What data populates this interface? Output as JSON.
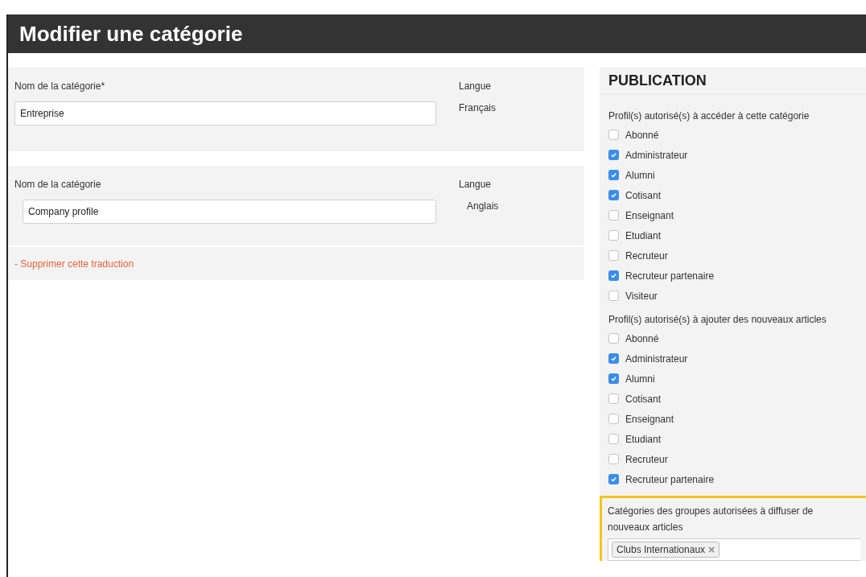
{
  "header": {
    "title": "Modifier une catégorie"
  },
  "translations": [
    {
      "name_label": "Nom de la catégorie*",
      "name_value": "Entreprise",
      "lang_label": "Langue",
      "lang_value": "Français",
      "indented": false
    },
    {
      "name_label": "Nom de la catégorie",
      "name_value": "Company profile",
      "lang_label": "Langue",
      "lang_value": "Anglais",
      "indented": true
    }
  ],
  "remove_link": "- Supprimer cette traduction",
  "publication": {
    "title": "PUBLICATION",
    "groups": [
      {
        "label": "Profil(s) autorisé(s) à accéder à cette catégorie",
        "options": [
          {
            "label": "Abonné",
            "checked": false
          },
          {
            "label": "Administrateur",
            "checked": true
          },
          {
            "label": "Alumni",
            "checked": true
          },
          {
            "label": "Cotisant",
            "checked": true
          },
          {
            "label": "Enseignant",
            "checked": false
          },
          {
            "label": "Etudiant",
            "checked": false
          },
          {
            "label": "Recruteur",
            "checked": false
          },
          {
            "label": "Recruteur partenaire",
            "checked": true
          },
          {
            "label": "Visiteur",
            "checked": false
          }
        ]
      },
      {
        "label": "Profil(s) autorisé(s) à ajouter des nouveaux articles",
        "options": [
          {
            "label": "Abonné",
            "checked": false
          },
          {
            "label": "Administrateur",
            "checked": true
          },
          {
            "label": "Alumni",
            "checked": true
          },
          {
            "label": "Cotisant",
            "checked": false
          },
          {
            "label": "Enseignant",
            "checked": false
          },
          {
            "label": "Etudiant",
            "checked": false
          },
          {
            "label": "Recruteur",
            "checked": false
          },
          {
            "label": "Recruteur partenaire",
            "checked": true
          }
        ]
      }
    ],
    "group_categories": {
      "label": "Catégories des groupes autorisées à diffuser de nouveaux articles",
      "tags": [
        "Clubs Internationaux"
      ]
    }
  }
}
